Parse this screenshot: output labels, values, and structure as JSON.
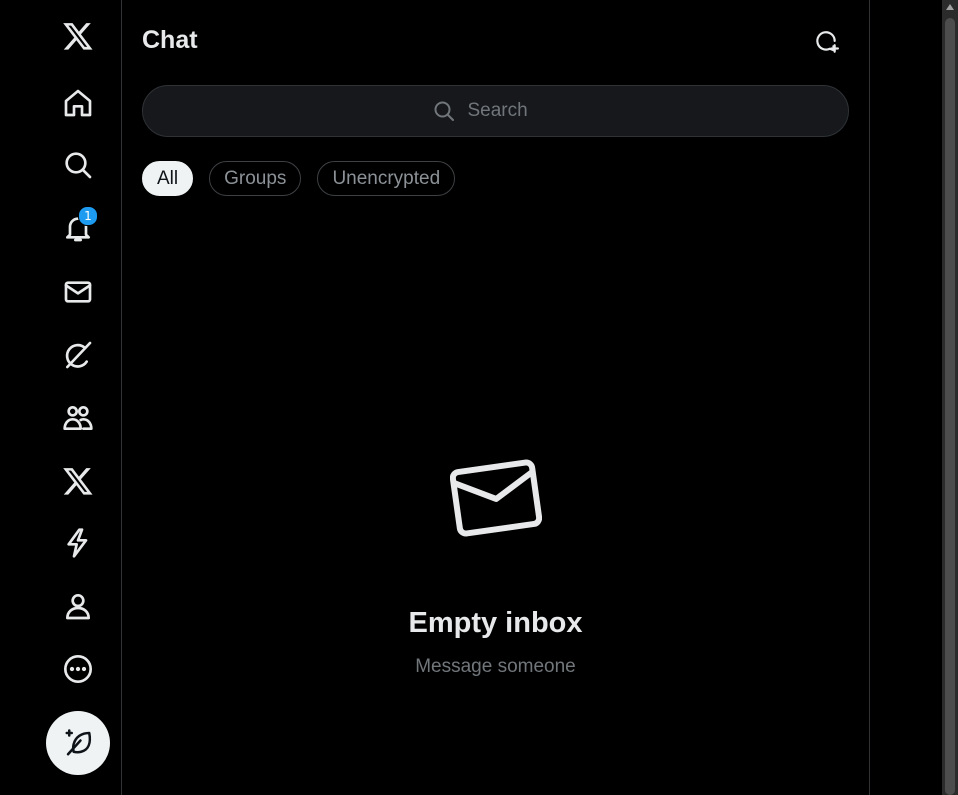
{
  "nav": {
    "items": [
      {
        "name": "x-logo-icon"
      },
      {
        "name": "home-icon"
      },
      {
        "name": "search-icon"
      },
      {
        "name": "notifications-icon",
        "badge": "1"
      },
      {
        "name": "messages-icon"
      },
      {
        "name": "grok-icon"
      },
      {
        "name": "communities-icon"
      },
      {
        "name": "premium-icon"
      },
      {
        "name": "lightning-icon"
      },
      {
        "name": "profile-icon"
      },
      {
        "name": "more-icon"
      }
    ],
    "compose_icon": "compose-post-icon"
  },
  "chat": {
    "title": "Chat",
    "new_chat_icon": "new-chat-icon",
    "search": {
      "placeholder": "Search",
      "value": ""
    },
    "filters": [
      {
        "label": "All",
        "active": true
      },
      {
        "label": "Groups",
        "active": false
      },
      {
        "label": "Unencrypted",
        "active": false
      }
    ],
    "empty_state": {
      "icon": "envelope-icon",
      "title": "Empty inbox",
      "subtitle": "Message someone"
    }
  },
  "colors": {
    "background": "#000000",
    "text": "#e7e9ea",
    "muted": "#71767b",
    "border": "#2f3336",
    "badge": "#1d9bf0"
  }
}
